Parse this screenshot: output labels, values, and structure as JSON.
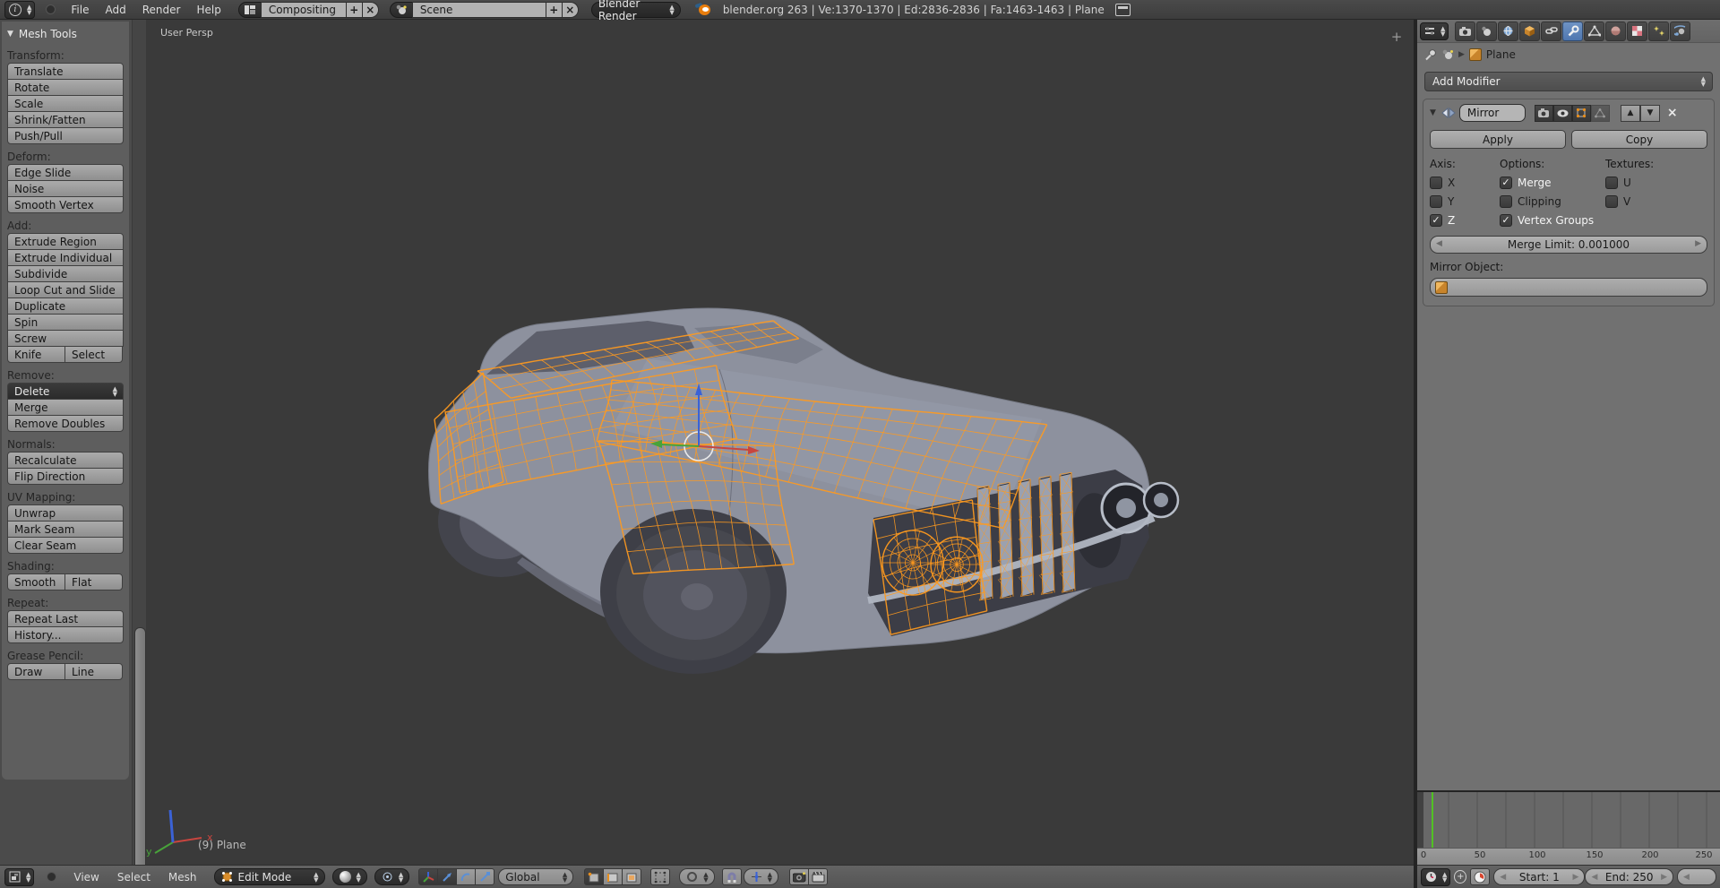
{
  "colors": {
    "selection_wireframe": "#ff9a1e",
    "active_tab": "#5680c2",
    "current_frame_marker": "#52c125",
    "axis_x": "#c8453f",
    "axis_y": "#48a33a",
    "axis_z": "#3a62d6"
  },
  "top_header": {
    "menus": [
      "File",
      "Add",
      "Render",
      "Help"
    ],
    "screen_layout": "Compositing",
    "scene": "Scene",
    "render_engine": "Blender Render",
    "stats": "blender.org 263 | Ve:1370-1370 | Ed:2836-2836 | Fa:1463-1463 | Plane"
  },
  "tool_shelf": {
    "title": "Mesh Tools",
    "labels": {
      "transform": "Transform:",
      "deform": "Deform:",
      "add": "Add:",
      "remove": "Remove:",
      "normals": "Normals:",
      "uv_mapping": "UV Mapping:",
      "shading": "Shading:",
      "repeat": "Repeat:",
      "grease_pencil": "Grease Pencil:"
    },
    "buttons": {
      "translate": "Translate",
      "rotate": "Rotate",
      "scale": "Scale",
      "shrink_fatten": "Shrink/Fatten",
      "push_pull": "Push/Pull",
      "edge_slide": "Edge Slide",
      "noise": "Noise",
      "smooth_vertex": "Smooth Vertex",
      "extrude_region": "Extrude Region",
      "extrude_individual": "Extrude Individual",
      "subdivide": "Subdivide",
      "loop_cut": "Loop Cut and Slide",
      "duplicate": "Duplicate",
      "spin": "Spin",
      "screw": "Screw",
      "knife": "Knife",
      "select": "Select",
      "delete": "Delete",
      "merge": "Merge",
      "remove_doubles": "Remove Doubles",
      "recalculate": "Recalculate",
      "flip_direction": "Flip Direction",
      "unwrap": "Unwrap",
      "mark_seam": "Mark Seam",
      "clear_seam": "Clear Seam",
      "smooth": "Smooth",
      "flat": "Flat",
      "repeat_last": "Repeat Last",
      "history": "History...",
      "draw": "Draw",
      "line": "Line"
    }
  },
  "viewport": {
    "view_label": "User Persp",
    "object_info": "(9) Plane",
    "axis_x": "x",
    "axis_y": "y"
  },
  "properties": {
    "breadcrumb_object": "Plane",
    "add_modifier_label": "Add Modifier",
    "modifier": {
      "name": "Mirror",
      "apply_label": "Apply",
      "copy_label": "Copy",
      "axis_label": "Axis:",
      "options_label": "Options:",
      "textures_label": "Textures:",
      "axis_x": "X",
      "axis_y": "Y",
      "axis_z": "Z",
      "merge": "Merge",
      "clipping": "Clipping",
      "vertex_groups": "Vertex Groups",
      "tex_u": "U",
      "tex_v": "V",
      "checked": {
        "axis_x": false,
        "axis_y": false,
        "axis_z": true,
        "merge": true,
        "clipping": false,
        "vertex_groups": true,
        "tex_u": false,
        "tex_v": false
      },
      "merge_limit": "Merge Limit: 0.001000",
      "mirror_object_label": "Mirror Object:"
    }
  },
  "timeline": {
    "ticks": [
      "0",
      "50",
      "100",
      "150",
      "200",
      "250"
    ],
    "start": "Start: 1",
    "end": "End: 250",
    "current_frame": 9
  },
  "view3d_header": {
    "menus": [
      "View",
      "Select",
      "Mesh"
    ],
    "mode": "Edit Mode",
    "orientation": "Global"
  }
}
